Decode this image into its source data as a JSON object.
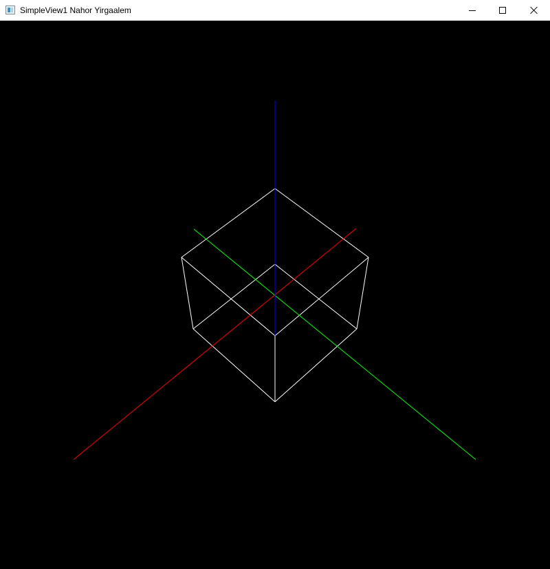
{
  "window": {
    "title": "SimpleView1 Nahor Yirgaalem",
    "icon": "app-window-icon",
    "controls": {
      "minimize_icon": "minimize-icon",
      "maximize_icon": "maximize-icon",
      "close_icon": "close-icon"
    }
  },
  "viewport": {
    "background": "#000000",
    "axes": {
      "x_color": "#ff0000",
      "y_color": "#00ff00",
      "z_color": "#0000ff"
    },
    "cube": {
      "color": "#ffffff",
      "style": "wireframe"
    }
  }
}
